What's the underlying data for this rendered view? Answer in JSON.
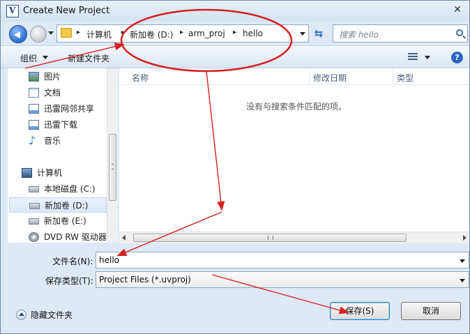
{
  "window": {
    "title": "Create New Project",
    "close_glyph": "✕"
  },
  "address_bar": {
    "crumbs": [
      "计算机",
      "新加卷 (D:)",
      "arm_proj",
      "hello"
    ],
    "separator": "▸"
  },
  "search": {
    "placeholder": "搜索 hello"
  },
  "toolbar": {
    "organize_label": "组织",
    "new_folder_label": "新建文件夹",
    "help_label": "?"
  },
  "nav_pane": {
    "items": [
      {
        "label": "图片",
        "icon": "pictures-icon"
      },
      {
        "label": "文档",
        "icon": "documents-icon"
      },
      {
        "label": "迅雷网邻共享",
        "icon": "share-icon"
      },
      {
        "label": "迅雷下载",
        "icon": "download-folder-icon"
      },
      {
        "label": "音乐",
        "icon": "music-icon"
      },
      {
        "label": "计算机",
        "icon": "computer-icon"
      },
      {
        "label": "本地磁盘 (C:)",
        "icon": "drive-icon"
      },
      {
        "label": "新加卷 (D:)",
        "icon": "drive-icon",
        "selected": true
      },
      {
        "label": "新加卷 (E:)",
        "icon": "drive-icon"
      },
      {
        "label": "DVD RW 驱动器",
        "icon": "cd-drive-icon"
      }
    ]
  },
  "file_list": {
    "columns": [
      "名称",
      "修改日期",
      "类型"
    ],
    "empty_message": "没有与搜索条件匹配的项。"
  },
  "form": {
    "filename_label": "文件名(N):",
    "filename_value": "hello",
    "filetype_label": "保存类型(T):",
    "filetype_value": "Project Files (*.uvproj)"
  },
  "footer": {
    "hide_folders_label": "隐藏文件夹",
    "save_label": "保存(S)",
    "cancel_label": "取消"
  },
  "colors": {
    "annotation": "#d42020",
    "accent": "#2c64c0"
  }
}
